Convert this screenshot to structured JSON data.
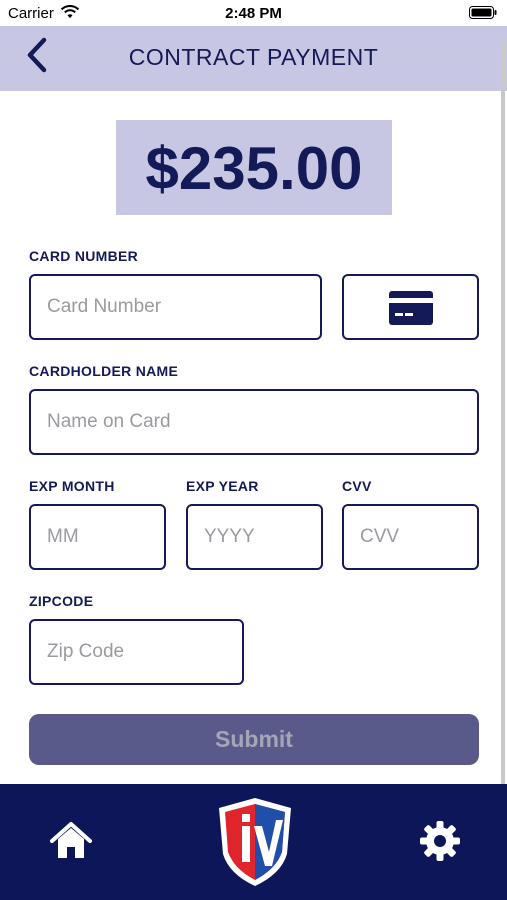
{
  "status_bar": {
    "carrier": "Carrier",
    "time": "2:48 PM"
  },
  "header": {
    "title": "CONTRACT PAYMENT",
    "back_icon": "chevron-left-icon"
  },
  "amount": "$235.00",
  "form": {
    "card_number": {
      "label": "CARD NUMBER",
      "placeholder": "Card Number",
      "value": ""
    },
    "card_scan_icon": "credit-card-icon",
    "cardholder_name": {
      "label": "CARDHOLDER NAME",
      "placeholder": "Name on Card",
      "value": ""
    },
    "exp_month": {
      "label": "EXP MONTH",
      "placeholder": "MM",
      "value": ""
    },
    "exp_year": {
      "label": "EXP YEAR",
      "placeholder": "YYYY",
      "value": ""
    },
    "cvv": {
      "label": "CVV",
      "placeholder": "CVV",
      "value": ""
    },
    "zipcode": {
      "label": "ZIPCODE",
      "placeholder": "Zip Code",
      "value": ""
    },
    "submit_label": "Submit"
  },
  "tab_bar": {
    "home_icon": "home-icon",
    "logo_icon": "shield-logo-icon",
    "settings_icon": "gear-icon"
  },
  "colors": {
    "primary": "#131a57",
    "header_bg": "#c7c6e3",
    "tab_bar_bg": "#0d1659",
    "submit_bg": "#5a5a8a",
    "logo_red": "#e0262c",
    "logo_blue": "#1f4fa8"
  }
}
